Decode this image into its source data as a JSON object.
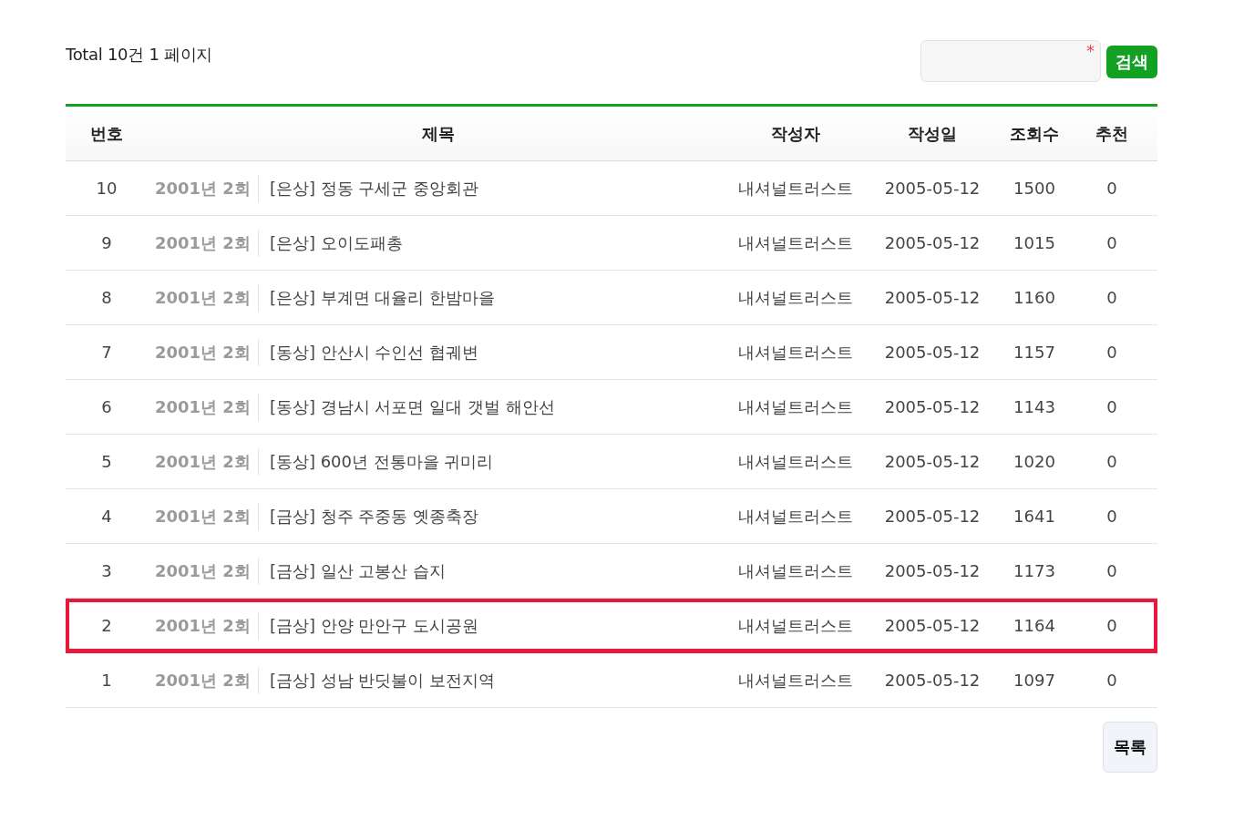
{
  "summary": "Total 10건 1 페이지",
  "search": {
    "required_mark": "*",
    "button": "검색"
  },
  "table": {
    "columns": [
      "번호",
      "제목",
      "작성자",
      "작성일",
      "조회수",
      "추천"
    ],
    "rows": [
      {
        "number": "10",
        "category": "2001년 2회",
        "title": "[은상] 정동 구세군 중앙회관",
        "author": "내셔널트러스트",
        "date": "2005-05-12",
        "views": "1500",
        "recommend": "0",
        "highlighted": false
      },
      {
        "number": "9",
        "category": "2001년 2회",
        "title": "[은상] 오이도패총",
        "author": "내셔널트러스트",
        "date": "2005-05-12",
        "views": "1015",
        "recommend": "0",
        "highlighted": false
      },
      {
        "number": "8",
        "category": "2001년 2회",
        "title": "[은상] 부계면 대율리 한밤마을",
        "author": "내셔널트러스트",
        "date": "2005-05-12",
        "views": "1160",
        "recommend": "0",
        "highlighted": false
      },
      {
        "number": "7",
        "category": "2001년 2회",
        "title": "[동상] 안산시 수인선 협궤변",
        "author": "내셔널트러스트",
        "date": "2005-05-12",
        "views": "1157",
        "recommend": "0",
        "highlighted": false
      },
      {
        "number": "6",
        "category": "2001년 2회",
        "title": "[동상] 경남시 서포면 일대 갯벌 해안선",
        "author": "내셔널트러스트",
        "date": "2005-05-12",
        "views": "1143",
        "recommend": "0",
        "highlighted": false
      },
      {
        "number": "5",
        "category": "2001년 2회",
        "title": "[동상] 600년 전통마을 귀미리",
        "author": "내셔널트러스트",
        "date": "2005-05-12",
        "views": "1020",
        "recommend": "0",
        "highlighted": false
      },
      {
        "number": "4",
        "category": "2001년 2회",
        "title": "[금상] 청주 주중동 옛종축장",
        "author": "내셔널트러스트",
        "date": "2005-05-12",
        "views": "1641",
        "recommend": "0",
        "highlighted": false
      },
      {
        "number": "3",
        "category": "2001년 2회",
        "title": "[금상] 일산 고봉산 습지",
        "author": "내셔널트러스트",
        "date": "2005-05-12",
        "views": "1173",
        "recommend": "0",
        "highlighted": false
      },
      {
        "number": "2",
        "category": "2001년 2회",
        "title": "[금상] 안양 만안구 도시공원",
        "author": "내셔널트러스트",
        "date": "2005-05-12",
        "views": "1164",
        "recommend": "0",
        "highlighted": true
      },
      {
        "number": "1",
        "category": "2001년 2회",
        "title": "[금상] 성남 반딧불이 보전지역",
        "author": "내셔널트러스트",
        "date": "2005-05-12",
        "views": "1097",
        "recommend": "0",
        "highlighted": false
      }
    ]
  },
  "list_button": "목록"
}
